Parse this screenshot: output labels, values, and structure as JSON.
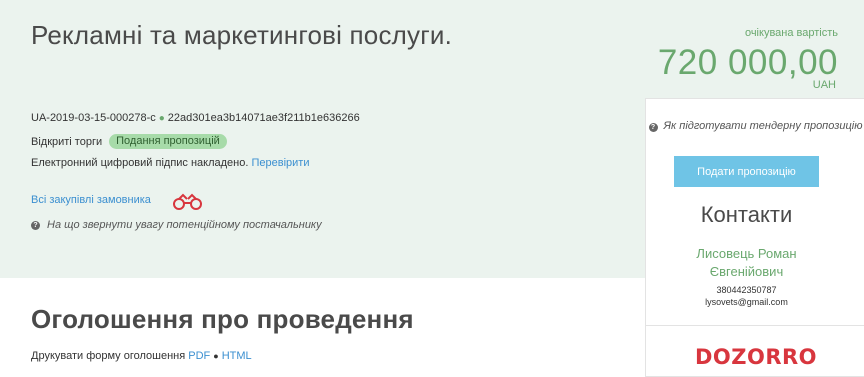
{
  "header": {
    "title": "Рекламні та маркетингові послуги.",
    "expected": {
      "label": "очікувана вартість",
      "value": "720 000,00",
      "currency": "UAH"
    },
    "tender_id": "UA-2019-03-15-000278-c",
    "hash": "22ad301ea3b14071ae3f211b1e636266",
    "procedure_type": "Відкриті торги",
    "status_badge": "Подання пропозицій",
    "signature_text": "Електронний цифровий підпис накладено.",
    "signature_link": "Перевірити",
    "all_purchases_link": "Всі закупівлі замовника",
    "notice_text": "На що звернути увагу потенційному постачальнику"
  },
  "sidebar": {
    "howto_text": "Як підготувати тендерну пропозицію",
    "submit_button": "Подати пропозицію",
    "contacts_title": "Контакти",
    "contact_name_line1": "Лисовець Роман",
    "contact_name_line2": "Євгенійович",
    "contact_phone": "380442350787",
    "contact_email": "lysovets@gmail.com",
    "logo_text": "DOZORRO",
    "colors": {
      "brand_red": "#d8363e",
      "accent_green": "#6aa86e",
      "button_blue": "#6fc4e6"
    }
  },
  "announcement": {
    "title": "Оголошення про проведення",
    "print_text": "Друкувати форму оголошення",
    "pdf_link": "PDF",
    "html_link": "HTML"
  }
}
